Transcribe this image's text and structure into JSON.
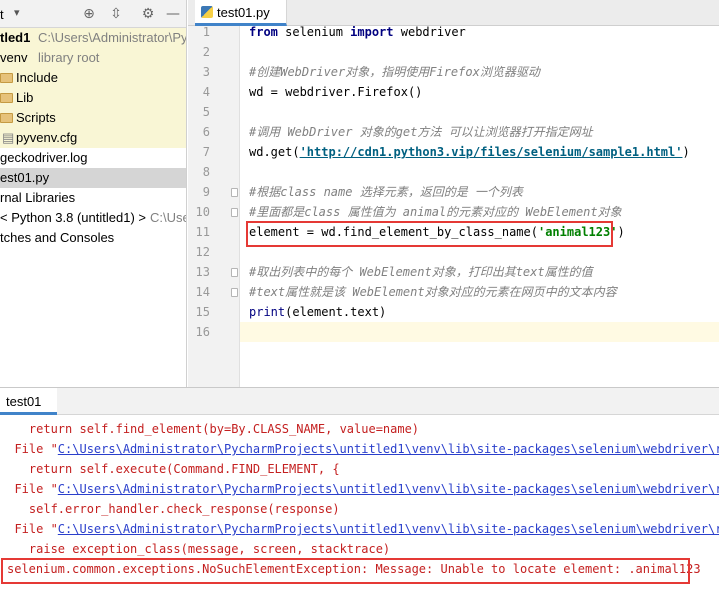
{
  "project": {
    "toolbar_label": "t",
    "rows": [
      {
        "text": "tled1",
        "muted": "C:\\Users\\Administrator\\Py",
        "bold": true
      },
      {
        "text": "venv",
        "muted": "library root"
      },
      {
        "text": "Include"
      },
      {
        "text": "Lib"
      },
      {
        "text": "Scripts"
      },
      {
        "text": "pyvenv.cfg"
      },
      {
        "text": "geckodriver.log"
      },
      {
        "text": "est01.py"
      },
      {
        "text": "rnal Libraries"
      },
      {
        "text": "< Python 3.8 (untitled1) >",
        "muted": "C:\\Use"
      },
      {
        "text": "tches and Consoles"
      }
    ]
  },
  "editor": {
    "tab_label": "test01.py",
    "line_numbers": [
      "1",
      "2",
      "3",
      "4",
      "5",
      "6",
      "7",
      "8",
      "9",
      "10",
      "11",
      "12",
      "13",
      "14",
      "15",
      "16"
    ],
    "lines": {
      "l1_kw1": "from",
      "l1_mod": " selenium ",
      "l1_kw2": "import",
      "l1_name": " webdriver",
      "l3": "#创建WebDriver对象，指明使用Firefox浏览器驱动",
      "l4": "wd = webdriver.Firefox()",
      "l6": "#调用 WebDriver 对象的get方法 可以让浏览器打开指定网址",
      "l7_a": "wd.get(",
      "l7_url": "'http://cdn1.python3.vip/files/selenium/sample1.html'",
      "l7_b": ")",
      "l9": "#根据class name 选择元素，返回的是 一个列表",
      "l10": "#里面都是class 属性值为 animal的元素对应的 WebElement对象",
      "l11_a": "element = wd.find_element_by_class_name(",
      "l11_str": "'animal123'",
      "l11_b": ")",
      "l13": "#取出列表中的每个 WebElement对象，打印出其text属性的值",
      "l14": "#text属性就是该 WebElement对象对应的元素在网页中的文本内容",
      "l15_fn": "print",
      "l15_rest": "(element.text)"
    }
  },
  "run": {
    "tab_label": "test01",
    "out": [
      {
        "indent": "    ",
        "text": "return self.find_element(by=By.CLASS_NAME, value=name)"
      },
      {
        "prefix": "  File \"",
        "path": "C:\\Users\\Administrator\\PycharmProjects\\untitled1\\venv\\lib\\site-packages\\selenium\\webdriver\\remote"
      },
      {
        "indent": "    ",
        "text": "return self.execute(Command.FIND_ELEMENT, {"
      },
      {
        "prefix": "  File \"",
        "path": "C:\\Users\\Administrator\\PycharmProjects\\untitled1\\venv\\lib\\site-packages\\selenium\\webdriver\\remote"
      },
      {
        "indent": "    ",
        "text": "self.error_handler.check_response(response)"
      },
      {
        "prefix": "  File \"",
        "path": "C:\\Users\\Administrator\\PycharmProjects\\untitled1\\venv\\lib\\site-packages\\selenium\\webdriver\\remote"
      },
      {
        "indent": "    ",
        "text": "raise exception_class(message, screen, stacktrace)"
      },
      {
        "text": "selenium.common.exceptions.NoSuchElementException: Message: Unable to locate element: .animal123"
      }
    ]
  },
  "colors": {
    "highlight_box": "#e53935",
    "tab_accent": "#4083c9",
    "error_text": "#c42020"
  }
}
